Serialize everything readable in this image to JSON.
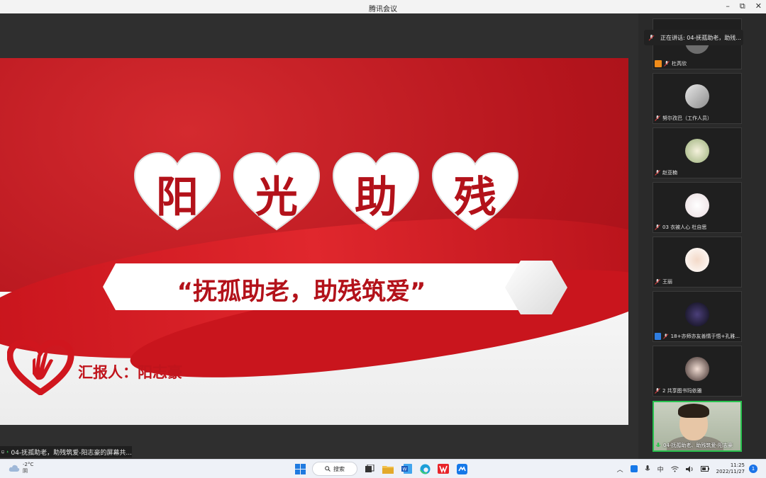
{
  "window": {
    "title": "腾讯会议",
    "minimize": "–",
    "restore": "⧉",
    "close": "✕"
  },
  "slide": {
    "hearts": [
      "阳",
      "光",
      "助",
      "残"
    ],
    "slogan": "“抚孤助老，助残筑爱”",
    "reporter": "汇报人：阳志豪",
    "colors": {
      "primary_red": "#b3121a",
      "white": "#ffffff"
    }
  },
  "share_label": "04-抚孤助老，助残筑爱-阳志豪的屏幕共...",
  "speaking": "正在讲话: 04-抚孤助老，助残...",
  "participants": [
    {
      "name": "杜芮欣",
      "badge": "orange"
    },
    {
      "name": "努尔孜巴（工作人员）",
      "badge": ""
    },
    {
      "name": "赵亚楠",
      "badge": ""
    },
    {
      "name": "03 衣被人心 杜自思",
      "badge": ""
    },
    {
      "name": "王丽",
      "badge": ""
    },
    {
      "name": "18+亦师亦友善情于悟+孔雅...",
      "badge": "blue"
    },
    {
      "name": "2 共享图书玛依雅",
      "badge": ""
    }
  ],
  "self_video": {
    "name": "04-抚孤助老、助残筑爱-阳志豪"
  },
  "taskbar": {
    "temperature": "-2°C",
    "weather": "阴",
    "search_label": "搜索",
    "ime": "中",
    "time": "11:25",
    "date": "2022/11/27",
    "notification_count": "1"
  }
}
